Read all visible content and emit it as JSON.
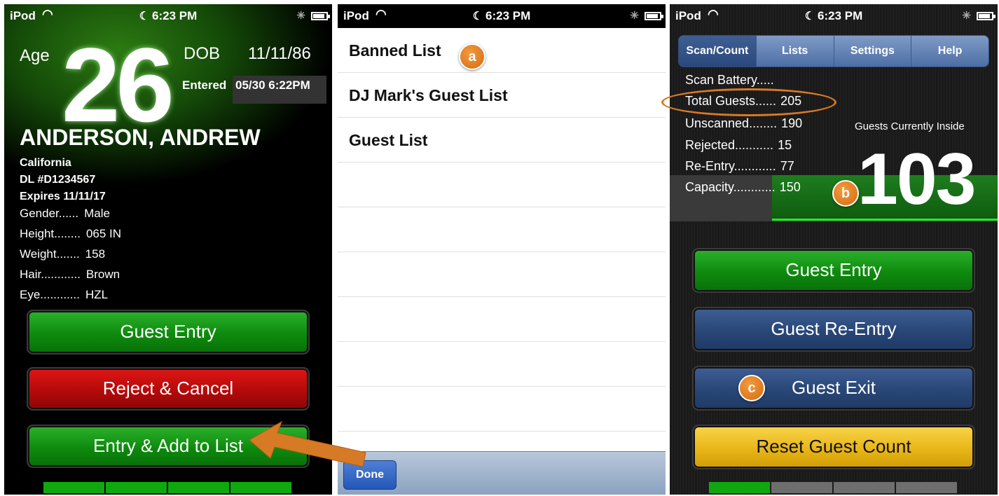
{
  "statusbar": {
    "carrier": "iPod",
    "time": "6:23 PM"
  },
  "scan_screen": {
    "age_label": "Age",
    "age": "26",
    "dob_label": "DOB",
    "dob": "11/11/86",
    "entered_label": "Entered",
    "entered_value": "05/30 6:22PM",
    "name": "ANDERSON, ANDREW",
    "state": "California",
    "dl": "DL #D1234567",
    "expires": "Expires 11/11/17",
    "fields": [
      {
        "label": "Gender......",
        "value": "Male"
      },
      {
        "label": "Height........",
        "value": "065 IN"
      },
      {
        "label": "Weight.......",
        "value": "158"
      },
      {
        "label": "Hair............",
        "value": "Brown"
      },
      {
        "label": "Eye............",
        "value": "HZL"
      }
    ],
    "buttons": {
      "guest_entry": "Guest Entry",
      "reject_cancel": "Reject & Cancel",
      "entry_add": "Entry & Add to List"
    },
    "bar_colors": [
      "#0fa80f",
      "#0fa80f",
      "#0fa80f",
      "#0fa80f"
    ]
  },
  "lists_screen": {
    "items": [
      "Banned List",
      "DJ Mark's Guest List",
      "Guest List"
    ],
    "done_label": "Done"
  },
  "count_screen": {
    "tabs": [
      "Scan/Count",
      "Lists",
      "Settings",
      "Help"
    ],
    "active_tab": "Scan/Count",
    "scan_battery": "Scan Battery.....",
    "stats": [
      {
        "label": "Total Guests......",
        "value": "205"
      },
      {
        "label": "Unscanned........",
        "value": "190"
      },
      {
        "label": "Rejected...........",
        "value": "15"
      },
      {
        "label": "Re-Entry............",
        "value": "77"
      },
      {
        "label": "Capacity............",
        "value": "150"
      }
    ],
    "inside_label": "Guests Currently Inside",
    "inside_count": "103",
    "capacity_fill_fraction": 0.687,
    "buttons": {
      "guest_entry": "Guest Entry",
      "guest_reentry": "Guest Re-Entry",
      "guest_exit": "Guest Exit",
      "reset": "Reset Guest Count"
    },
    "bar_colors": [
      "#0fa80f",
      "#6e6e6e",
      "#6e6e6e",
      "#6e6e6e"
    ]
  },
  "annotations": {
    "a": "a",
    "b": "b",
    "c": "c"
  },
  "colors": {
    "accent_orange": "#d77a25",
    "green": "#0e8a0e",
    "red": "#b40a0a",
    "blue": "#284777",
    "yellow": "#e9b618"
  }
}
